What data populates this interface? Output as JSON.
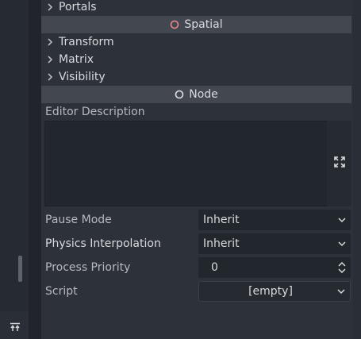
{
  "colors": {
    "spatial_icon": "#e8878b",
    "node_icon": "#e0e0e0",
    "panel_bg": "#2d3139",
    "category_bg": "#434750",
    "field_bg": "#22262d"
  },
  "inspector": {
    "sections_top": [
      {
        "label": "Portals",
        "icon": "chevron-right-icon"
      }
    ],
    "spatial_category": {
      "label": "Spatial",
      "icon": "spatial-node-icon"
    },
    "spatial_sections": [
      {
        "label": "Transform",
        "icon": "chevron-right-icon"
      },
      {
        "label": "Matrix",
        "icon": "chevron-right-icon"
      },
      {
        "label": "Visibility",
        "icon": "chevron-right-icon"
      }
    ],
    "node_category": {
      "label": "Node",
      "icon": "node-icon"
    },
    "editor_description": {
      "label": "Editor Description",
      "value": "",
      "expand_icon": "expand-icon"
    },
    "properties": {
      "pause_mode": {
        "label": "Pause Mode",
        "value": "Inherit"
      },
      "physics_interpolation": {
        "label": "Physics Interpolation",
        "value": "Inherit"
      },
      "process_priority": {
        "label": "Process Priority",
        "value": "0"
      },
      "script": {
        "label": "Script",
        "value": "[empty]"
      }
    }
  }
}
